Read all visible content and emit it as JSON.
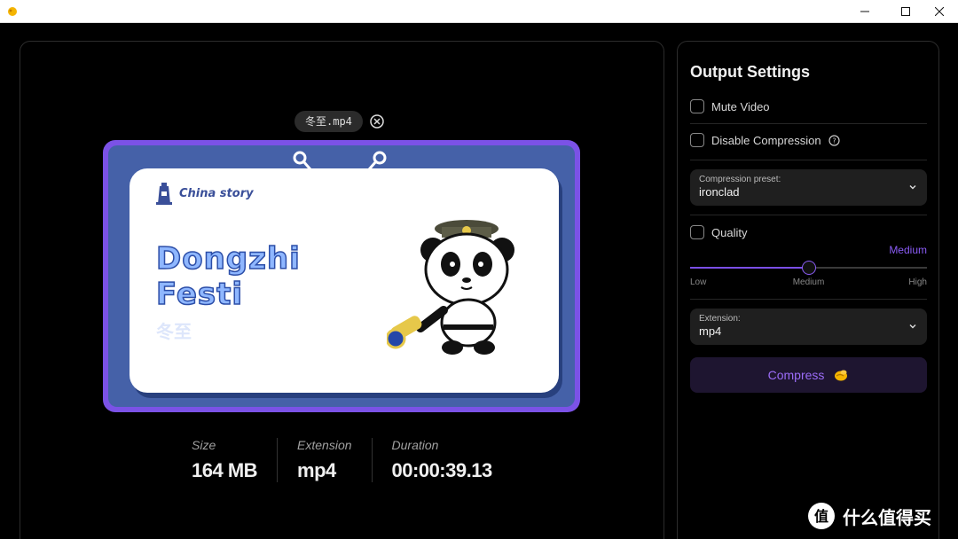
{
  "titlebar": {
    "minimize_glyph": "—",
    "maximize_glyph": "☐",
    "close_glyph": "✕"
  },
  "file": {
    "name": "冬至.mp4"
  },
  "preview": {
    "logo_text": "China story",
    "title_line1": "Dongzhi",
    "title_line2": "Festi",
    "subtitle": "冬至"
  },
  "stats": [
    {
      "label": "Size",
      "value": "164 MB"
    },
    {
      "label": "Extension",
      "value": "mp4"
    },
    {
      "label": "Duration",
      "value": "00:00:39.13"
    }
  ],
  "settings": {
    "title": "Output Settings",
    "mute_video": {
      "label": "Mute Video",
      "checked": false
    },
    "disable_compression": {
      "label": "Disable Compression",
      "checked": false
    },
    "compression_preset": {
      "label": "Compression preset:",
      "value": "ironclad"
    },
    "quality": {
      "label": "Quality",
      "checked": false,
      "level": "Medium",
      "value_fraction": 0.5,
      "marks": [
        "Low",
        "Medium",
        "High"
      ]
    },
    "extension": {
      "label": "Extension:",
      "value": "mp4"
    },
    "compress_button": "Compress"
  },
  "watermark": {
    "text": "什么值得买"
  },
  "colors": {
    "accent": "#8a5cf6",
    "preview_frame": "#7b52e6",
    "preview_bg": "#4561a8"
  }
}
